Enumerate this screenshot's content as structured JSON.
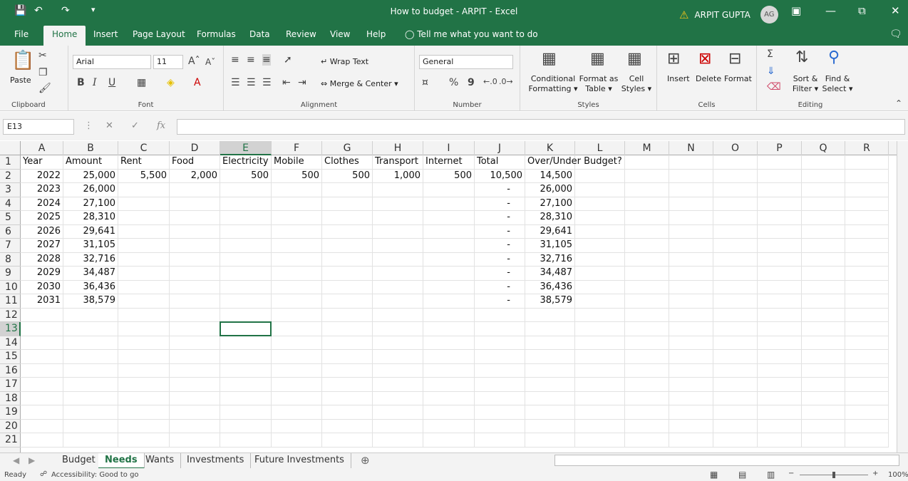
{
  "titlebar": {
    "title": "How to budget - ARPIT  -  Excel",
    "user": "ARPIT GUPTA",
    "initials": "AG"
  },
  "tabs": [
    "File",
    "Home",
    "Insert",
    "Page Layout",
    "Formulas",
    "Data",
    "Review",
    "View",
    "Help"
  ],
  "tell_me": "Tell me what you want to do",
  "ribbon": {
    "clipboard": {
      "paste": "Paste",
      "label": "Clipboard"
    },
    "font": {
      "name": "Arial",
      "size": "11",
      "label": "Font",
      "bold": "B",
      "italic": "I",
      "underline": "U"
    },
    "alignment": {
      "wrap": "Wrap Text",
      "merge": "Merge & Center",
      "label": "Alignment"
    },
    "number": {
      "format": "General",
      "label": "Number",
      "percent": "%",
      "comma": "9"
    },
    "styles": {
      "conditional1": "Conditional",
      "conditional2": "Formatting",
      "format_as1": "Format as",
      "format_as2": "Table",
      "cell_styles1": "Cell",
      "cell_styles2": "Styles",
      "label": "Styles"
    },
    "cells": {
      "insert": "Insert",
      "delete": "Delete",
      "format": "Format",
      "label": "Cells"
    },
    "editing": {
      "sort1": "Sort &",
      "sort2": "Filter",
      "find1": "Find &",
      "find2": "Select",
      "label": "Editing"
    }
  },
  "namebox": "E13",
  "columns": [
    "A",
    "B",
    "C",
    "D",
    "E",
    "F",
    "G",
    "H",
    "I",
    "J",
    "K",
    "L",
    "M",
    "N",
    "O",
    "P",
    "Q",
    "R"
  ],
  "rows": [
    "1",
    "2",
    "3",
    "4",
    "5",
    "6",
    "7",
    "8",
    "9",
    "10",
    "11",
    "12",
    "13",
    "14",
    "15",
    "16",
    "17",
    "18",
    "19",
    "20",
    "21"
  ],
  "headers": [
    "Year",
    "Amount",
    "Rent",
    "Food",
    "Electricity",
    "Mobile",
    "Clothes",
    "Transport",
    "Internet",
    "Total",
    "Over/Under Budget?"
  ],
  "data": [
    [
      "2022",
      "25,000",
      "5,500",
      "2,000",
      "500",
      "500",
      "500",
      "1,000",
      "500",
      "10,500",
      "14,500"
    ],
    [
      "2023",
      "26,000",
      "",
      "",
      "",
      "",
      "",
      "",
      "",
      "-",
      "26,000"
    ],
    [
      "2024",
      "27,100",
      "",
      "",
      "",
      "",
      "",
      "",
      "",
      "-",
      "27,100"
    ],
    [
      "2025",
      "28,310",
      "",
      "",
      "",
      "",
      "",
      "",
      "",
      "-",
      "28,310"
    ],
    [
      "2026",
      "29,641",
      "",
      "",
      "",
      "",
      "",
      "",
      "",
      "-",
      "29,641"
    ],
    [
      "2027",
      "31,105",
      "",
      "",
      "",
      "",
      "",
      "",
      "",
      "-",
      "31,105"
    ],
    [
      "2028",
      "32,716",
      "",
      "",
      "",
      "",
      "",
      "",
      "",
      "-",
      "32,716"
    ],
    [
      "2029",
      "34,487",
      "",
      "",
      "",
      "",
      "",
      "",
      "",
      "-",
      "34,487"
    ],
    [
      "2030",
      "36,436",
      "",
      "",
      "",
      "",
      "",
      "",
      "",
      "-",
      "36,436"
    ],
    [
      "2031",
      "38,579",
      "",
      "",
      "",
      "",
      "",
      "",
      "",
      "-",
      "38,579"
    ]
  ],
  "sheet_tabs": [
    "Budget",
    "Needs",
    "Wants",
    "Investments",
    "Future Investments"
  ],
  "status": {
    "ready": "Ready",
    "accessibility": "Accessibility: Good to go",
    "zoom": "100%"
  }
}
